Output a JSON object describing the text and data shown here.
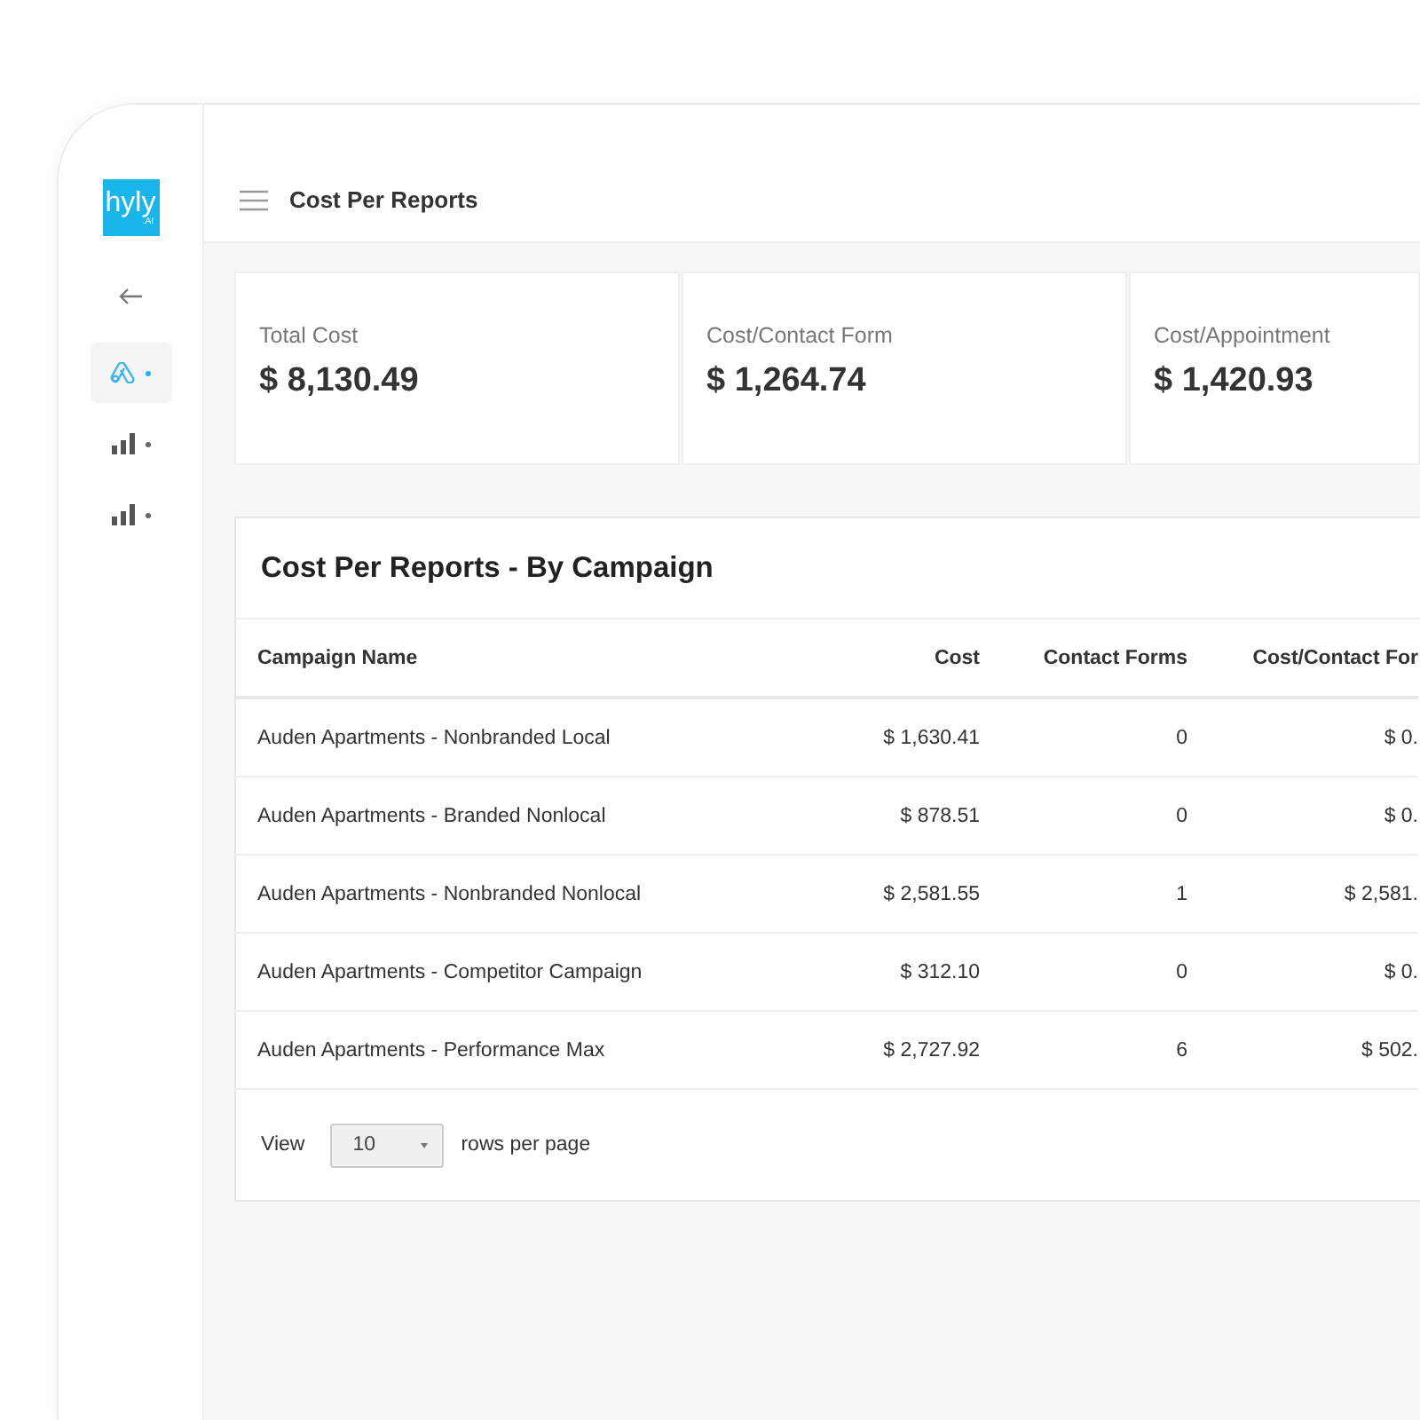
{
  "logo": {
    "text": "hyly",
    "subtext": ".AI"
  },
  "sidebar": {
    "items": [
      {
        "kind": "ads",
        "selected": true
      },
      {
        "kind": "chart",
        "selected": false
      },
      {
        "kind": "chart",
        "selected": false
      }
    ]
  },
  "header": {
    "title": "Cost Per Reports"
  },
  "stats": [
    {
      "label": "Total Cost",
      "value": "$ 8,130.49"
    },
    {
      "label": "Cost/Contact Form",
      "value": "$ 1,264.74"
    },
    {
      "label": "Cost/Appointment",
      "value": "$ 1,420.93"
    }
  ],
  "table": {
    "title": "Cost Per Reports - By Campaign",
    "columns": [
      "Campaign Name",
      "Cost",
      "Contact Forms",
      "Cost/Contact For"
    ],
    "rows": [
      [
        "Auden Apartments - Nonbranded Local",
        "$ 1,630.41",
        "0",
        "$ 0."
      ],
      [
        "Auden Apartments - Branded Nonlocal",
        "$ 878.51",
        "0",
        "$ 0."
      ],
      [
        "Auden Apartments - Nonbranded Nonlocal",
        "$ 2,581.55",
        "1",
        "$ 2,581."
      ],
      [
        "Auden Apartments - Competitor Campaign",
        "$ 312.10",
        "0",
        "$ 0."
      ],
      [
        "Auden Apartments - Performance Max",
        "$ 2,727.92",
        "6",
        "$ 502."
      ]
    ],
    "pagination": {
      "label": "View",
      "value": "10",
      "suffix": "rows per page"
    }
  }
}
